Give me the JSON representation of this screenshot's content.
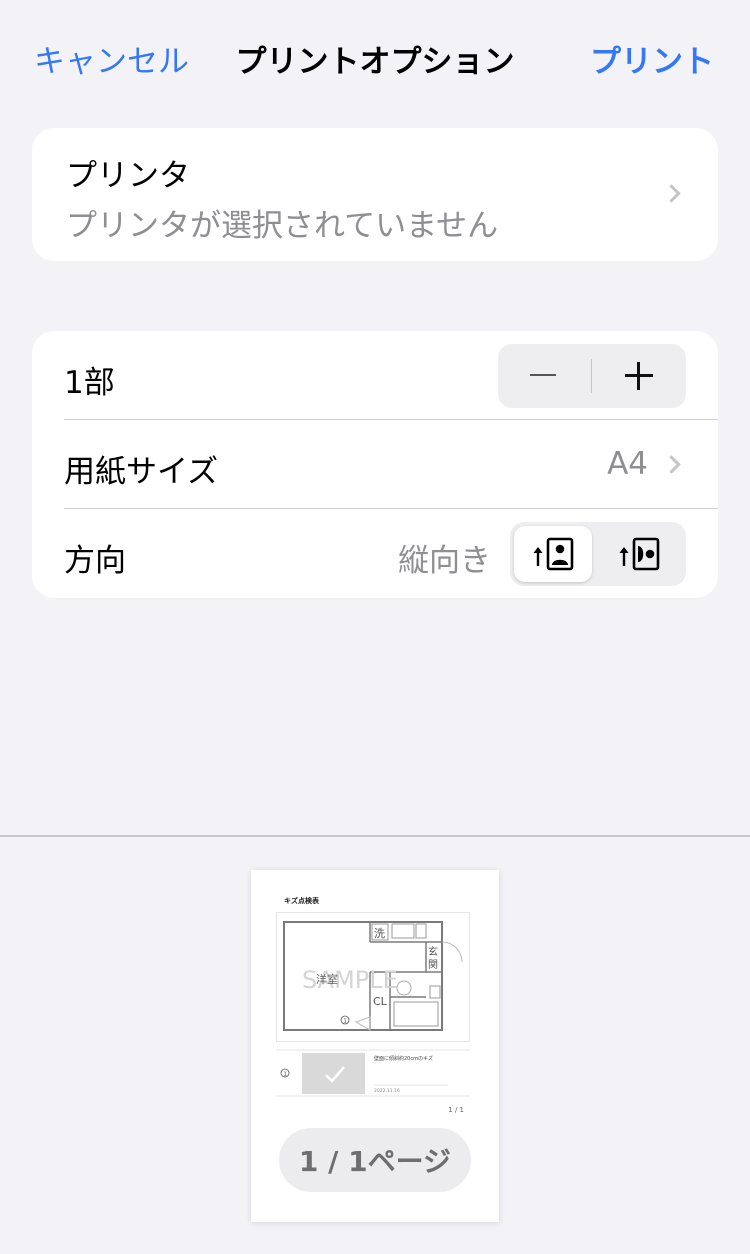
{
  "nav": {
    "cancel": "キャンセル",
    "title": "プリントオプション",
    "print": "プリント"
  },
  "printer": {
    "title": "プリンタ",
    "status": "プリンタが選択されていません"
  },
  "options": {
    "copies": {
      "label": "1部"
    },
    "paper": {
      "label": "用紙サイズ",
      "value": "A4"
    },
    "orientation": {
      "label": "方向",
      "value": "縦向き",
      "selected": "portrait"
    }
  },
  "preview": {
    "doc_title": "キズ点検表",
    "watermark": "SAMPLE",
    "rooms": {
      "wash": "洗",
      "entry1": "玄",
      "entry2": "関",
      "western": "洋室",
      "closet": "CL"
    },
    "marker": "1",
    "item_note": "壁面に傾斜約20cmのキズ",
    "item_date": "2022.11.16",
    "doc_page": "1 / 1",
    "page_label": "1 / 1ページ"
  },
  "colors": {
    "accent": "#3478f6",
    "background": "#f2f2f7",
    "secondary_text": "#8e8e93"
  },
  "icons": [
    "chevron-right-icon",
    "minus-icon",
    "plus-icon",
    "portrait-orientation-icon",
    "landscape-orientation-icon"
  ]
}
